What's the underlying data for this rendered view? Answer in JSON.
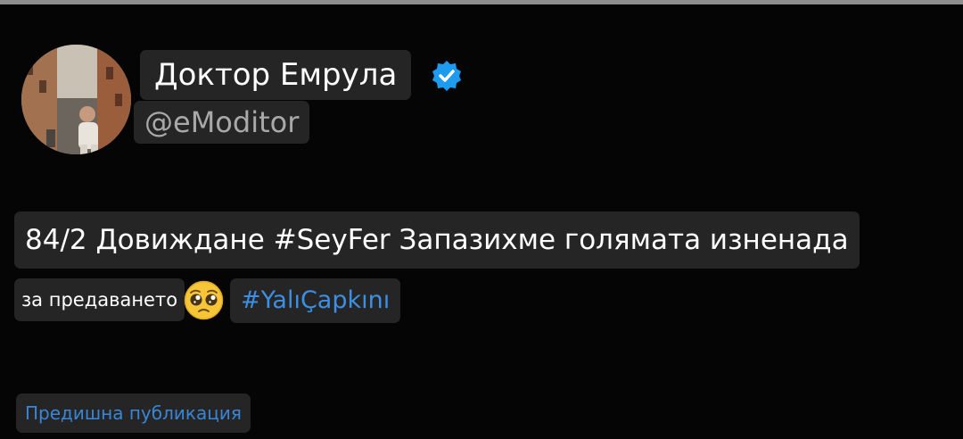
{
  "profile": {
    "display_name": "Доктор Емрула",
    "handle": "@eModitor",
    "verified_icon": "verified-badge-icon",
    "avatar_icon": "profile-photo"
  },
  "tweet": {
    "line1": "84/2 Довиждане #SeyFer Запазихме голямата изненада",
    "line2_text": "за предаването",
    "emoji": "pleading-face-emoji",
    "hashtag": "#YalıÇapkını"
  },
  "footer": {
    "previous_post_label": "Предишна публикация"
  },
  "colors": {
    "background": "#050505",
    "chip_background": "#252525",
    "link_blue": "#3d8fe3",
    "verified_blue": "#1d9bf0",
    "handle_grey": "#a9a9a9"
  }
}
